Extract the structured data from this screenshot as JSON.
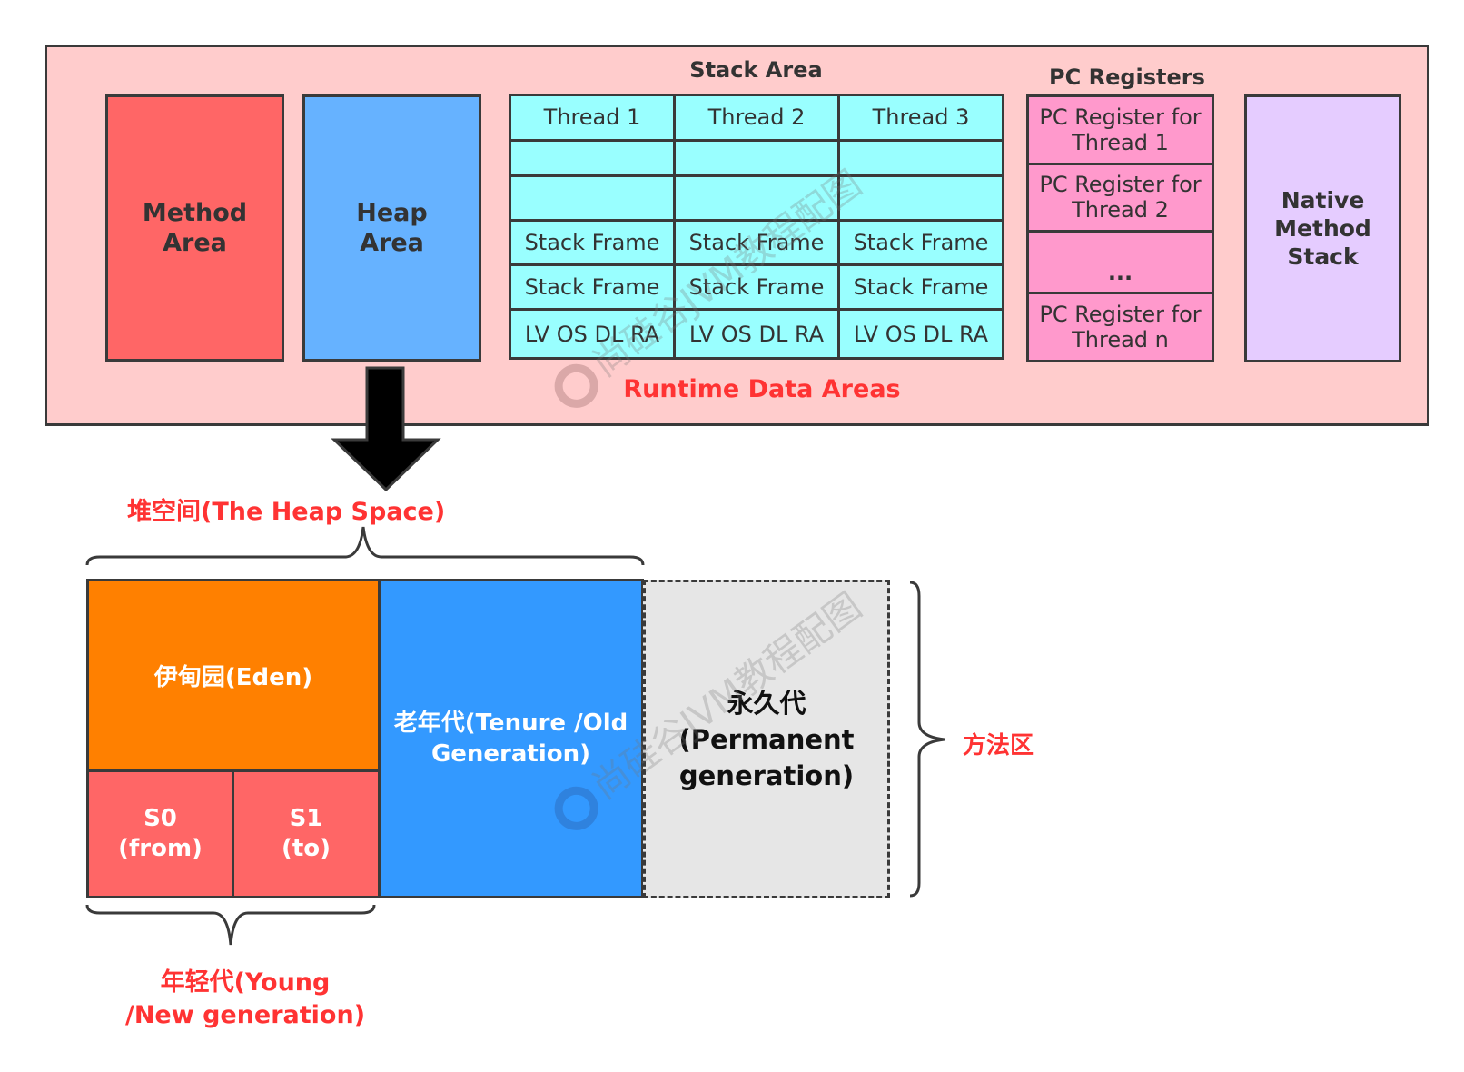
{
  "runtime_data_areas": {
    "title": "Runtime Data Areas",
    "method_area": "Method\nArea",
    "heap_area": "Heap\nArea",
    "stack_area": {
      "title": "Stack Area",
      "columns": [
        {
          "header": "Thread 1",
          "rows": [
            "",
            "",
            "Stack Frame",
            "Stack Frame",
            "LV OS DL RA"
          ]
        },
        {
          "header": "Thread 2",
          "rows": [
            "",
            "",
            "Stack Frame",
            "Stack Frame",
            "LV OS DL RA"
          ]
        },
        {
          "header": "Thread 3",
          "rows": [
            "",
            "",
            "Stack Frame",
            "Stack Frame",
            "LV OS DL RA"
          ]
        }
      ]
    },
    "pc_registers": {
      "title": "PC Registers",
      "items": [
        "PC Register for\nThread 1",
        "PC Register for\nThread 2",
        "...",
        "PC Register for\nThread n"
      ]
    },
    "native_method_stack": "Native\nMethod\nStack"
  },
  "heap_space": {
    "label": "堆空间(The Heap Space)",
    "eden": "伊甸园(Eden)",
    "s0": "S0\n(from)",
    "s1": "S1\n(to)",
    "old_generation": "老年代(Tenure /Old\nGeneration)",
    "young_generation_label": "年轻代(Young\n/New generation)"
  },
  "permanent_generation": {
    "label": "永久代\n(Permanent\ngeneration)",
    "method_area_label": "方法区"
  },
  "watermark": "尚硅谷JVM教程配图",
  "colors": {
    "runtime_bg": "#ffcccc",
    "method_area": "#ff6666",
    "heap_area": "#66b2ff",
    "stack_cell": "#99ffff",
    "pc_cell": "#ff99cc",
    "native_stack": "#e5ccff",
    "eden": "#ff8000",
    "survivor": "#ff6666",
    "old_generation": "#3399ff",
    "permanent": "#e6e6e6",
    "label_red": "#ff3333"
  }
}
